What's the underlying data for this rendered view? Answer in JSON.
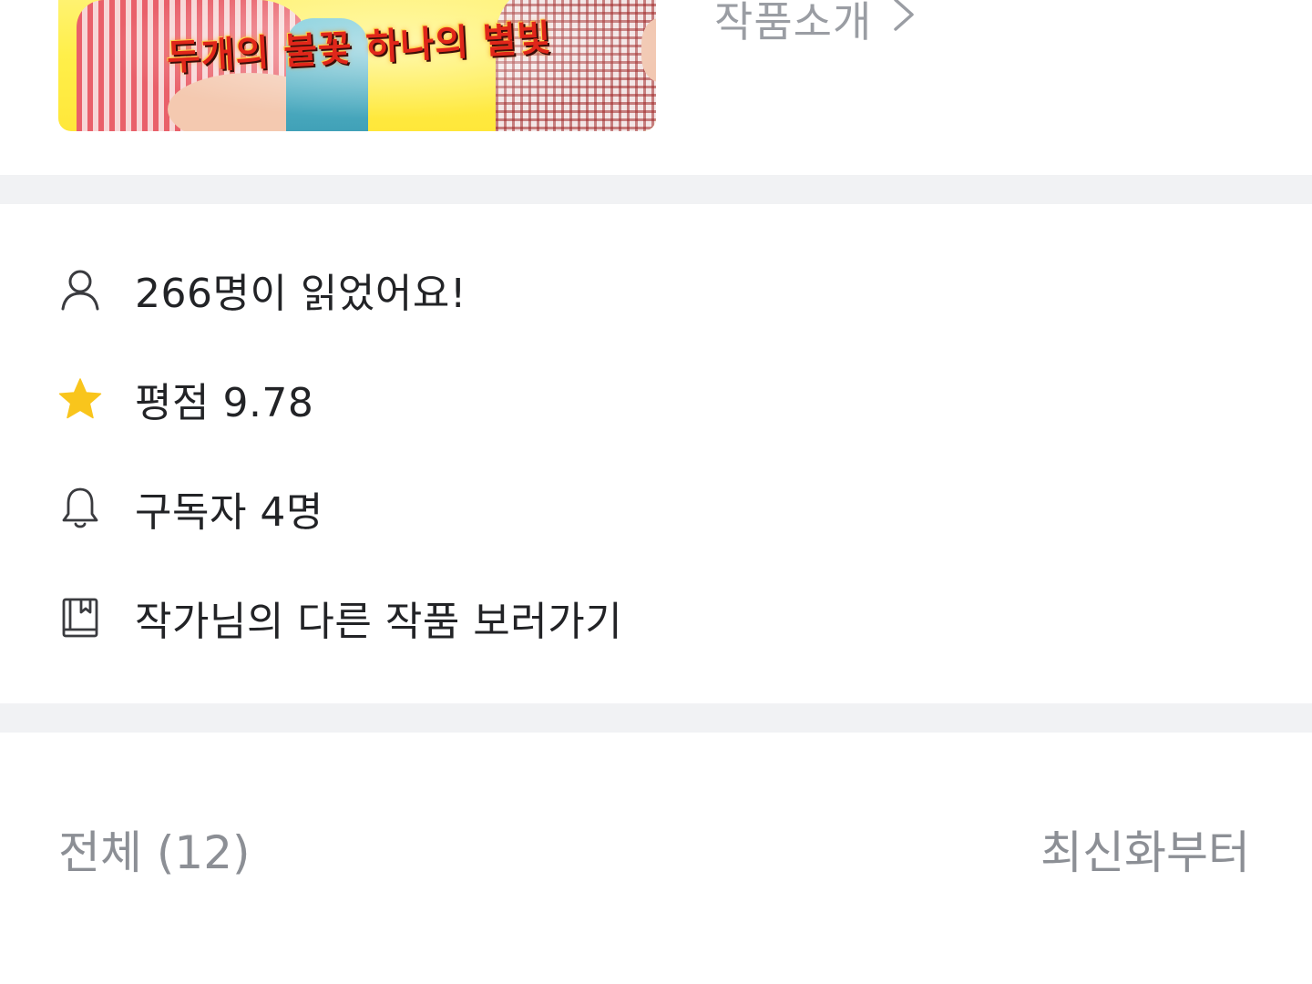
{
  "cover": {
    "title": "두개의 불꽃 하나의 별빛"
  },
  "intro": {
    "label": "작품소개",
    "chevron": "›"
  },
  "stats": {
    "readers": "266명이 읽었어요!",
    "rating": "평점 9.78",
    "subscribers": "구독자 4명",
    "other_works": "작가님의 다른 작품 보러가기"
  },
  "icons": {
    "readers": "person-icon",
    "rating": "star-icon",
    "subscribers": "bell-icon",
    "other_works": "book-icon"
  },
  "colors": {
    "star": "#f9c51c",
    "muted_text": "#8c8f95",
    "divider": "#f1f2f4"
  },
  "episodes": {
    "total_label": "전체 (12)",
    "sort_label": "최신화부터"
  }
}
